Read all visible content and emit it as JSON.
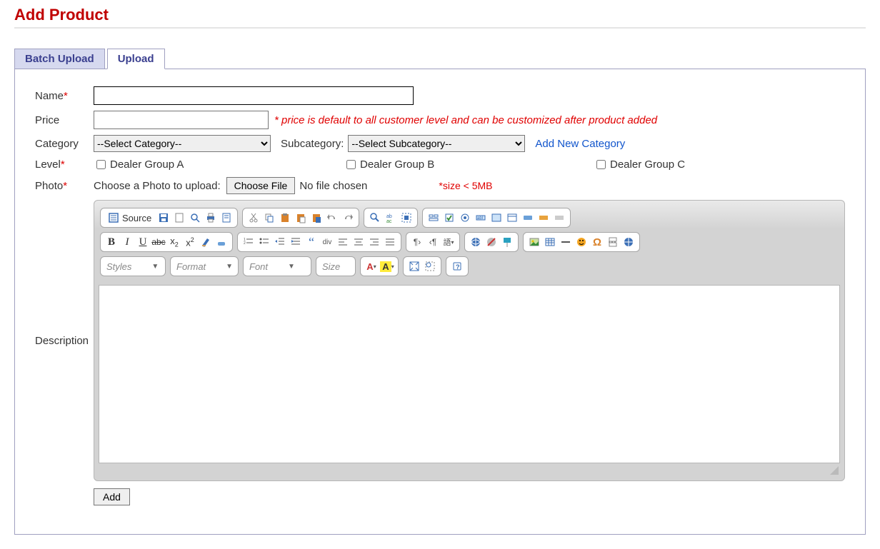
{
  "page_title": "Add Product",
  "tabs": {
    "batch": "Batch Upload",
    "upload": "Upload"
  },
  "labels": {
    "name": "Name",
    "price": "Price",
    "category": "Category",
    "subcategory": "Subcategory:",
    "level": "Level",
    "photo": "Photo",
    "description": "Description"
  },
  "notes": {
    "price": "* price is default to all customer level and can be customized after product added",
    "photo_prompt": "Choose a Photo to upload:",
    "file_status": "No file chosen",
    "size": "*size < 5MB"
  },
  "buttons": {
    "choose_file": "Choose File",
    "add": "Add",
    "add_category": "Add New Category",
    "source": "Source"
  },
  "selects": {
    "category": "--Select Category--",
    "subcategory": "--Select Subcategory--"
  },
  "dealer": {
    "a": "Dealer Group A",
    "b": "Dealer Group B",
    "c": "Dealer Group C"
  },
  "rte_dropdowns": {
    "styles": "Styles",
    "format": "Format",
    "font": "Font",
    "size": "Size"
  }
}
